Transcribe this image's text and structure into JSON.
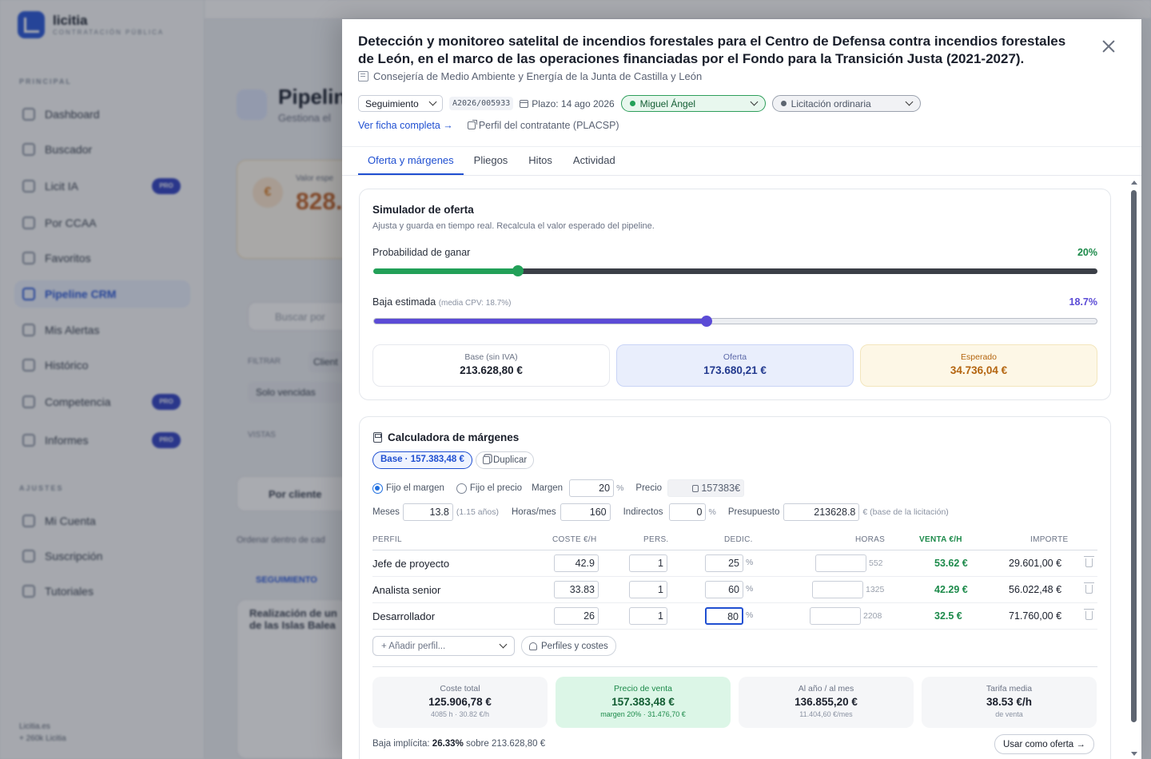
{
  "background": {
    "brand": "licitia",
    "brand_sub": "CONTRATACIÓN PÚBLICA",
    "section_main": "PRINCIPAL",
    "section_settings": "AJUSTES",
    "nav": [
      "Dashboard",
      "Buscador",
      "Licit IA",
      "Por CCAA",
      "Favoritos",
      "Pipeline CRM",
      "Mis Alertas",
      "Histórico",
      "Competencia",
      "Informes"
    ],
    "nav_settings": [
      "Mi Cuenta",
      "Suscripción",
      "Tutoriales"
    ],
    "pro_label": "PRO",
    "page_title": "Pipeline",
    "page_sub": "Gestiona el",
    "value_label": "Valor espe",
    "value": "828.",
    "search_placeholder": "Buscar por",
    "filter_label": "FILTRAR",
    "filter_chip": "Client",
    "vencidas_chip": "Solo vencidas",
    "vistas_label": "VISTAS",
    "por_cliente": "Por cliente",
    "ordenar": "Ordenar dentro de cad",
    "seguimiento_group": "SEGUIMIENTO",
    "card_title": "Realización de un\nde las Islas Balea",
    "footer_site": "Licitia.es",
    "footer_count": "+ 260k Licitia"
  },
  "panel": {
    "title": "Detección y monitoreo satelital de incendios forestales para el Centro de Defensa contra incendios forestales de León, en el marco de las operaciones financiadas por el Fondo para la Transición Justa (2021-2027).",
    "organismo": "Consejería de Medio Ambiente y Energía de la Junta de Castilla y León",
    "estado": "Seguimiento",
    "expediente": "A2026/005933",
    "plazo": "Plazo: 14 ago 2026",
    "responsable": "Miguel Ángel",
    "procedimiento": "Licitación ordinaria",
    "ver_ficha": "Ver ficha completa →",
    "perfil_contratante": "Perfil del contratante (PLACSP)",
    "tabs": [
      "Oferta y márgenes",
      "Pliegos",
      "Hitos",
      "Actividad"
    ]
  },
  "simulador": {
    "title": "Simulador de oferta",
    "subtitle": "Ajusta y guarda en tiempo real. Recalcula el valor esperado del pipeline.",
    "prob_label": "Probabilidad de ganar",
    "prob_value": "20%",
    "prob_fraction": 0.2,
    "baja_label": "Baja estimada",
    "baja_hint": "(media CPV: 18.7%)",
    "baja_value": "18.7%",
    "baja_fraction": 0.46,
    "base_label": "Base (sin IVA)",
    "base_value": "213.628,80 €",
    "oferta_label": "Oferta",
    "oferta_value": "173.680,21 €",
    "esperado_label": "Esperado",
    "esperado_value": "34.736,04 €"
  },
  "calculadora": {
    "title": "Calculadora de márgenes",
    "base_pill": "Base · 157.383,48 €",
    "duplicar": "Duplicar",
    "fijo_margen": "Fijo el margen",
    "fijo_precio": "Fijo el precio",
    "margen_label": "Margen",
    "margen_value": "20",
    "pct": "%",
    "precio_label": "Precio",
    "precio_value": "157383€",
    "meses_label": "Meses",
    "meses_value": "13.8",
    "meses_hint": "(1.15 años)",
    "horas_mes_label": "Horas/mes",
    "horas_mes_value": "160",
    "indirectos_label": "Indirectos",
    "indirectos_value": "0",
    "presupuesto_label": "Presupuesto",
    "presupuesto_value": "213628.8",
    "presupuesto_hint": "€ (base de la licitación)",
    "columns": [
      "PERFIL",
      "COSTE €/H",
      "PERS.",
      "DEDIC.",
      "HORAS",
      "VENTA €/H",
      "IMPORTE"
    ],
    "rows": [
      {
        "perfil": "Jefe de proyecto",
        "coste": "42.9",
        "pers": "1",
        "dedic": "25",
        "horas": "552",
        "venta": "53.62 €",
        "importe": "29.601,00 €"
      },
      {
        "perfil": "Analista senior",
        "coste": "33.83",
        "pers": "1",
        "dedic": "60",
        "horas": "1325",
        "venta": "42.29 €",
        "importe": "56.022,48 €"
      },
      {
        "perfil": "Desarrollador",
        "coste": "26",
        "pers": "1",
        "dedic": "80",
        "horas": "2208",
        "venta": "32.5 €",
        "importe": "71.760,00 €"
      }
    ],
    "add_perfil": "+ Añadir perfil...",
    "perfiles_costes": "Perfiles y costes",
    "kpis": [
      {
        "label": "Coste total",
        "value": "125.906,78 €",
        "sub": "4085 h · 30.82 €/h"
      },
      {
        "label": "Precio de venta",
        "value": "157.383,48 €",
        "sub": "margen 20% · 31.476,70 €"
      },
      {
        "label": "Al año / al mes",
        "value": "136.855,20 €",
        "sub": "11.404,60 €/mes"
      },
      {
        "label": "Tarifa media",
        "value": "38.53 €/h",
        "sub": "de venta"
      }
    ],
    "baja_implicita_label": "Baja implícita:",
    "baja_implicita_value": "26.33%",
    "baja_implicita_tail": "sobre 213.628,80 €",
    "usar_oferta": "Usar como oferta →"
  },
  "colors": {
    "accent": "#1f4fd1",
    "prob_green": "#22a058",
    "baja_purple": "#5b4bd6",
    "esperado_amber": "#b4650f",
    "venta_green": "#1c8a4a"
  }
}
